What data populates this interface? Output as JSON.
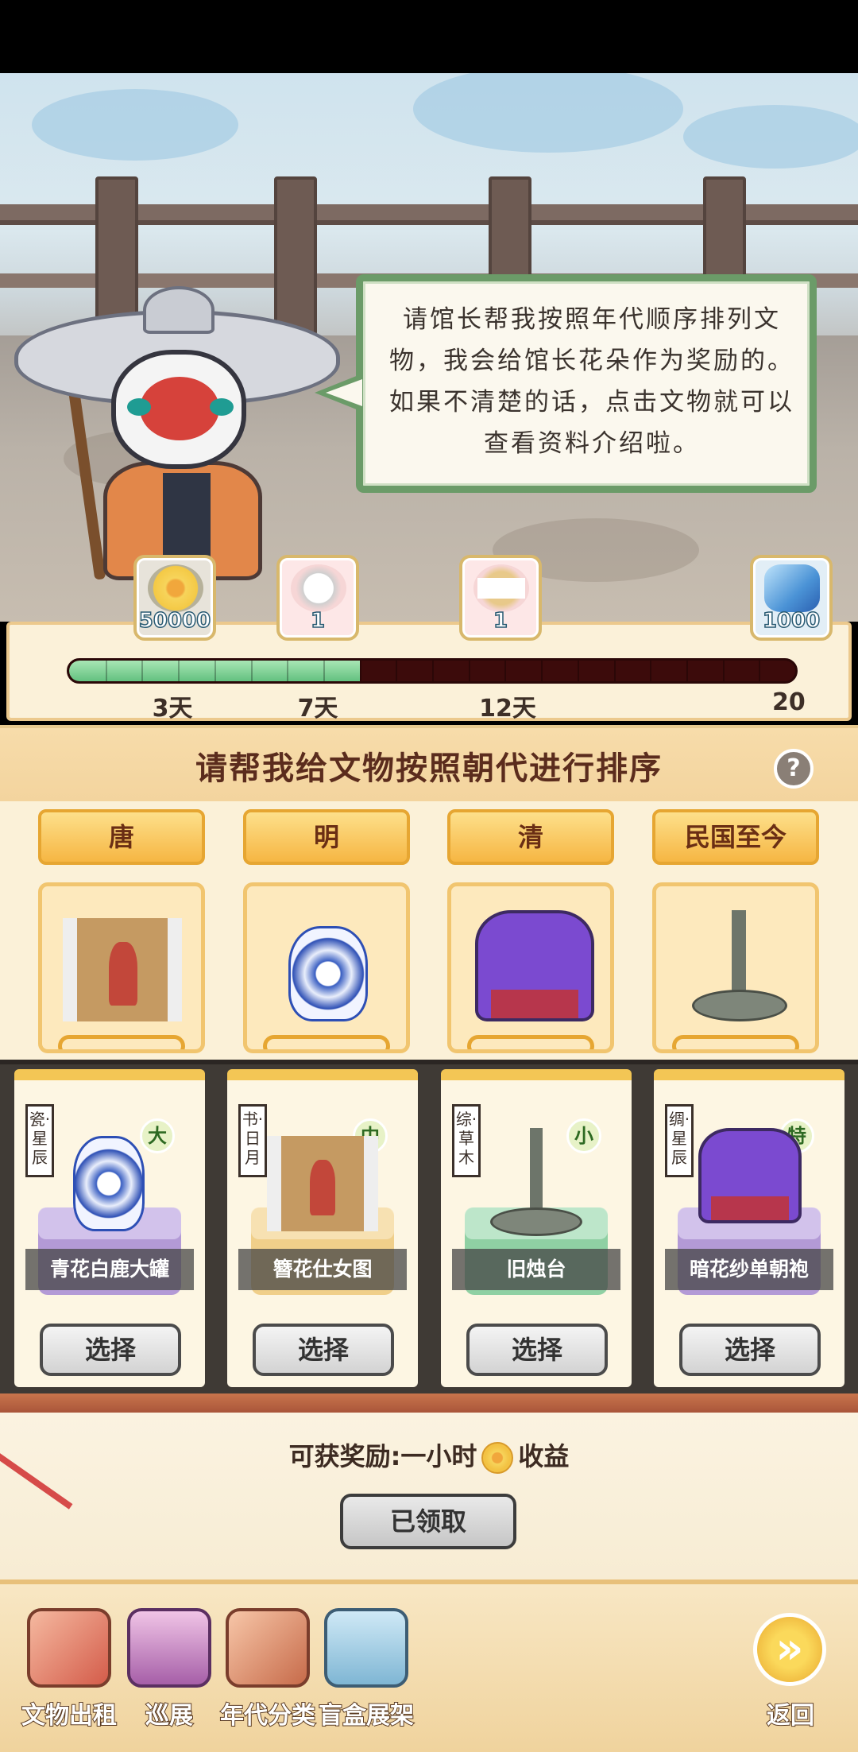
{
  "dialog": {
    "text": "请馆长帮我按照年代顺序排列文物，我会给馆长花朵作为奖励的。如果不清楚的话，点击文物就可以查看资料介绍啦。"
  },
  "progress": {
    "fraction": 0.4,
    "days": [
      "3天",
      "7天",
      "12天",
      "20天"
    ],
    "rewards": [
      {
        "amount": "50000",
        "icon": "flower-coin-icon"
      },
      {
        "amount": "1",
        "icon": "treasure-doll-icon"
      },
      {
        "amount": "1",
        "icon": "ticket-icon"
      },
      {
        "amount": "1000",
        "icon": "blue-gem-icon"
      }
    ]
  },
  "task": {
    "title": "请帮我给文物按照朝代进行排序",
    "help": "?",
    "eras": [
      "唐",
      "明",
      "清",
      "民国至今"
    ],
    "slots": [
      "scroll-painting-icon",
      "blue-white-jar-icon",
      "purple-robe-icon",
      "candlestick-icon"
    ]
  },
  "items": [
    {
      "name": "青花白鹿大罐",
      "tag": "瓷·星辰",
      "size": "大",
      "color": "#b39ad6",
      "button": "选择"
    },
    {
      "name": "簪花仕女图",
      "tag": "书·日月",
      "size": "中",
      "color": "#f0cf8a",
      "button": "选择"
    },
    {
      "name": "旧烛台",
      "tag": "综·草木",
      "size": "小",
      "color": "#8fd0a3",
      "button": "选择"
    },
    {
      "name": "暗花纱单朝袍",
      "tag": "绸·星辰",
      "size": "特",
      "color": "#b39ad6",
      "button": "选择"
    }
  ],
  "reward": {
    "prefix": "可获奖励:一小时",
    "suffix": "收益",
    "claimed_label": "已领取"
  },
  "nav": [
    {
      "label": "文物出租",
      "icon": "rental-icon"
    },
    {
      "label": "巡展",
      "icon": "tour-bus-icon"
    },
    {
      "label": "年代分类",
      "icon": "era-classify-icon"
    },
    {
      "label": "盲盒展架",
      "icon": "blind-box-icon"
    },
    {
      "label": "返回",
      "icon": "back-icon"
    }
  ]
}
